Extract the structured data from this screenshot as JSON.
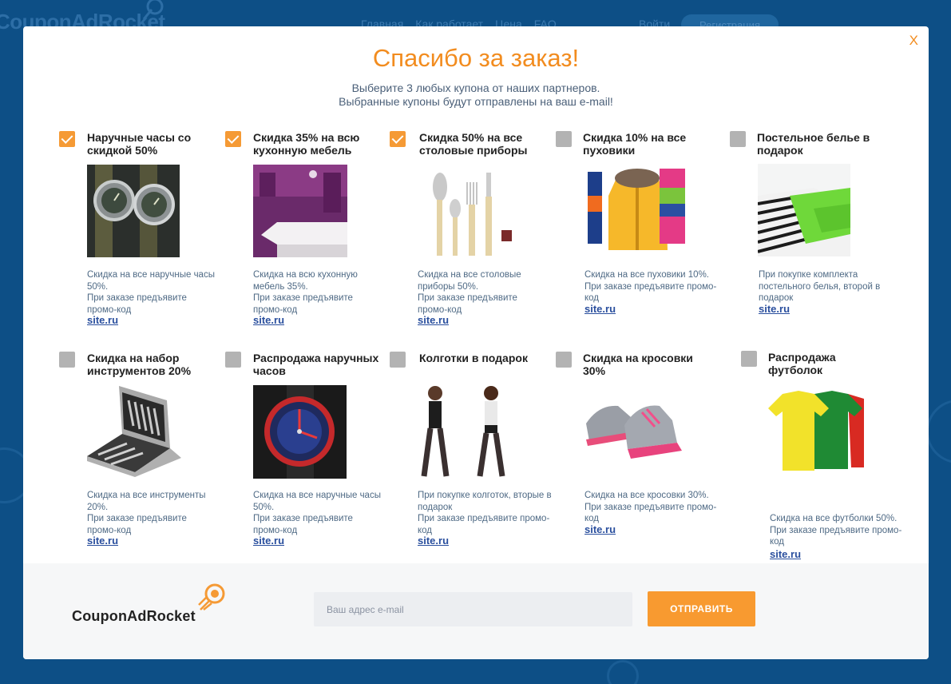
{
  "background": {
    "logo": "CouponAdRocket",
    "nav": [
      "Главная",
      "Как работает",
      "Цена",
      "FAQ"
    ],
    "login": "Войти",
    "register": "Регистрация"
  },
  "modal": {
    "close": "X",
    "title": "Спасибо за заказ!",
    "subtitle_line1": "Выберите 3 любых купона от наших партнеров.",
    "subtitle_line2": "Выбранные купоны будут отправлены на ваш e-mail!"
  },
  "coupons": [
    {
      "title": "Наручные часы со скидкой 50%",
      "checked": true,
      "image": "watches-photo",
      "desc": "Скидка на все наручные часы 50%.\nПри заказе предъявите промо-код",
      "link": "site.ru"
    },
    {
      "title": "Скидка 35% на всю кухонную мебель",
      "checked": true,
      "image": "kitchen-photo",
      "desc": "Скидка на всю кухонную мебель 35%.\nПри заказе предъявите промо-код",
      "link": "site.ru"
    },
    {
      "title": "Скидка 50% на все столовые приборы",
      "checked": true,
      "image": "cutlery-photo",
      "desc": "Скидка на все столовые приборы 50%.\nПри заказе предъявите промо-код",
      "link": "site.ru"
    },
    {
      "title": "Скидка 10% на все пуховики",
      "checked": false,
      "image": "jackets-photo",
      "desc": "Скидка на все пуховики 10%.\nПри заказе предъявите промо-код",
      "link": "site.ru"
    },
    {
      "title": "Постельное белье в подарок",
      "checked": false,
      "image": "bedding-photo",
      "desc": "При покупке комплекта постельного белья, второй в подарок",
      "link": "site.ru"
    },
    {
      "title": "Скидка на набор инструментов 20%",
      "checked": false,
      "image": "toolbox-photo",
      "desc": "Скидка на все инструменты 20%.\nПри заказе предъявите промо-код",
      "link": "site.ru"
    },
    {
      "title": "Распродажа наручных часов",
      "checked": false,
      "image": "wristwatch-photo",
      "desc": "Скидка на все наручные часы 50%.\nПри заказе предъявите промо-код",
      "link": "site.ru"
    },
    {
      "title": "Колготки в подарок",
      "checked": false,
      "image": "tights-photo",
      "desc": "При покупке колготок, вторые в подарок\nПри заказе предъявите промо-код",
      "link": "site.ru"
    },
    {
      "title": "Скидка на кросовки 30%",
      "checked": false,
      "image": "sneakers-photo",
      "desc": "Скидка на все кросовки 30%.\nПри заказе предъявите промо-код",
      "link": "site.ru"
    },
    {
      "title": "Распродажа футболок",
      "checked": false,
      "image": "tshirts-photo",
      "desc": "Скидка на все футболки 50%.\nПри заказе предъявите промо-код",
      "link": "site.ru"
    }
  ],
  "footer": {
    "logo": "CouponAdRocket",
    "email_placeholder": "Ваш адрес e-mail",
    "submit_label": "ОТПРАВИТЬ"
  },
  "colors": {
    "accent": "#f28c1f",
    "background": "#0d4f86",
    "checkbox_on": "#f59a35",
    "checkbox_off": "#b3b3b3",
    "link": "#2a4f9e"
  }
}
